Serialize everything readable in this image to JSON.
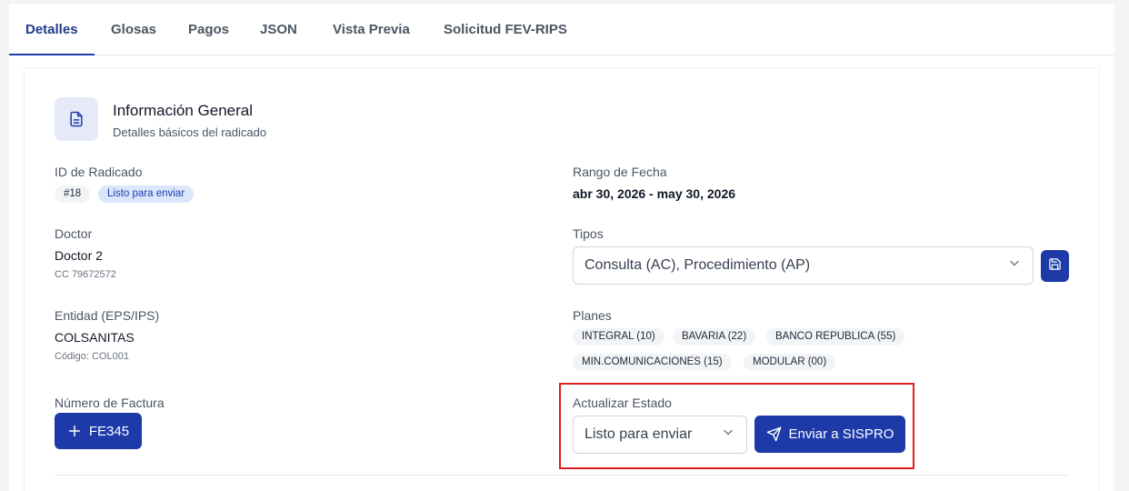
{
  "tabs": [
    {
      "label": "Detalles"
    },
    {
      "label": "Glosas"
    },
    {
      "label": "Pagos"
    },
    {
      "label": "JSON"
    },
    {
      "label": "Vista Previa"
    },
    {
      "label": "Solicitud FEV-RIPS"
    }
  ],
  "section": {
    "icon": "document-icon",
    "title": "Información General",
    "subtitle": "Detalles básicos del radicado"
  },
  "radicado": {
    "label": "ID de Radicado",
    "id": "#18",
    "status": "Listo para enviar"
  },
  "rango": {
    "label": "Rango de Fecha",
    "value": "abr 30, 2026 - may 30, 2026"
  },
  "doctor": {
    "label": "Doctor",
    "name": "Doctor 2",
    "doc": "CC 79672572"
  },
  "tipos": {
    "label": "Tipos",
    "value": "Consulta (AC), Procedimiento (AP)",
    "save_icon": "save-icon"
  },
  "entidad": {
    "label": "Entidad (EPS/IPS)",
    "name": "COLSANITAS",
    "code": "Código: COL001"
  },
  "planes": {
    "label": "Planes",
    "items": [
      "INTEGRAL (10)",
      "BAVARIA (22)",
      "BANCO REPUBLICA (55)",
      "MIN.COMUNICACIONES (15)",
      "MODULAR (00)"
    ]
  },
  "factura": {
    "label": "Número de Factura",
    "button": "FE345"
  },
  "estado": {
    "label": "Actualizar Estado",
    "value": "Listo para enviar",
    "send_button": "Enviar a SISPRO"
  },
  "colors": {
    "primary": "#1e3aa8",
    "accent_text": "#1e3a8a",
    "highlight": "#e11d1d"
  }
}
